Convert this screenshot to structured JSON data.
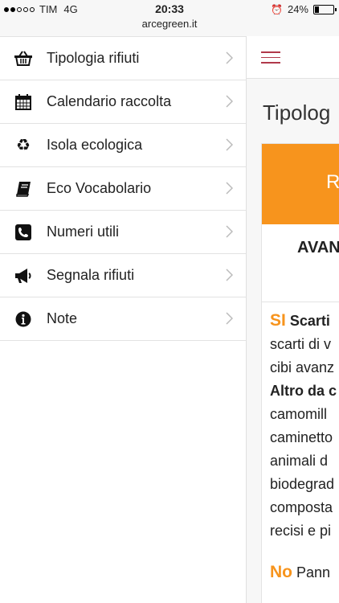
{
  "status": {
    "carrier": "TIM",
    "network": "4G",
    "time": "20:33",
    "battery": "24%",
    "battery_level": 0.24
  },
  "browser": {
    "url": "arcegreen.it"
  },
  "menu": {
    "items": [
      {
        "label": "Tipologia rifiuti",
        "icon": "basket-icon"
      },
      {
        "label": "Calendario raccolta",
        "icon": "calendar-icon"
      },
      {
        "label": "Isola ecologica",
        "icon": "recycle-icon"
      },
      {
        "label": "Eco Vocabolario",
        "icon": "book-icon"
      },
      {
        "label": "Numeri utili",
        "icon": "phone-icon"
      },
      {
        "label": "Segnala rifiuti",
        "icon": "megaphone-icon"
      },
      {
        "label": "Note",
        "icon": "info-icon"
      }
    ]
  },
  "main": {
    "title": "Tipolog",
    "card": {
      "header_letter": "R",
      "subtitle": "AVAN",
      "lines": {
        "si_label": "SI",
        "l1": "Scarti",
        "l2": "scarti di v",
        "l3": "cibi avanz",
        "l4": "Altro da c",
        "l5": "camomill",
        "l6": "caminetto",
        "l7": "animali d",
        "l8": "biodegrad",
        "l9": "composta",
        "l10": "recisi e pi",
        "no_label": "No",
        "l11": "Pann"
      }
    }
  },
  "colors": {
    "accent": "#f7941d",
    "hamburger": "#b0394a"
  }
}
